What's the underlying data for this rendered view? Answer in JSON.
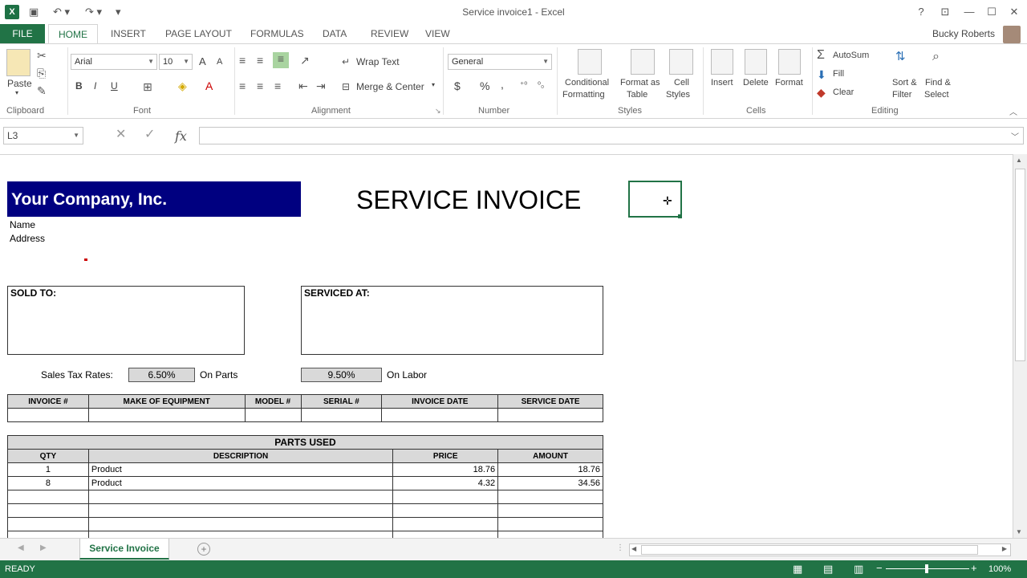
{
  "window": {
    "title": "Service invoice1 - Excel",
    "app_icon": "X"
  },
  "ribbon_tabs": [
    "FILE",
    "HOME",
    "INSERT",
    "PAGE LAYOUT",
    "FORMULAS",
    "DATA",
    "REVIEW",
    "VIEW"
  ],
  "user": {
    "name": "Bucky Roberts"
  },
  "ribbon": {
    "clipboard": {
      "label": "Clipboard",
      "paste": "Paste"
    },
    "font": {
      "label": "Font",
      "family": "Arial",
      "size": "10",
      "bold": "B",
      "italic": "I",
      "underline": "U",
      "grow": "A",
      "shrink": "A"
    },
    "alignment": {
      "label": "Alignment",
      "wrap": "Wrap Text",
      "merge": "Merge & Center"
    },
    "number": {
      "label": "Number",
      "format": "General",
      "currency": "$",
      "percent": "%",
      "comma": ","
    },
    "styles": {
      "label": "Styles",
      "conditional_1": "Conditional",
      "conditional_2": "Formatting",
      "format_table_1": "Format as",
      "format_table_2": "Table",
      "cell_styles_1": "Cell",
      "cell_styles_2": "Styles"
    },
    "cells": {
      "label": "Cells",
      "insert": "Insert",
      "delete": "Delete",
      "format": "Format"
    },
    "editing": {
      "label": "Editing",
      "autosum": "AutoSum",
      "fill": "Fill",
      "clear": "Clear",
      "sort_1": "Sort &",
      "sort_2": "Filter",
      "find_1": "Find &",
      "find_2": "Select"
    }
  },
  "formula_bar": {
    "name_box": "L3",
    "fx": "fx",
    "content": ""
  },
  "sheet": {
    "company": "Your Company, Inc.",
    "heading": "SERVICE INVOICE",
    "name_label": "Name",
    "address_label": "Address",
    "sold_to": "SOLD TO:",
    "serviced_at": "SERVICED AT:",
    "tax_label": "Sales Tax Rates:",
    "tax_parts": "6.50%",
    "on_parts": "On Parts",
    "tax_labor": "9.50%",
    "on_labor": "On Labor",
    "info_headers": [
      "INVOICE #",
      "MAKE OF EQUIPMENT",
      "MODEL #",
      "SERIAL #",
      "INVOICE DATE",
      "SERVICE DATE"
    ],
    "parts_title": "PARTS USED",
    "parts_headers": [
      "QTY",
      "DESCRIPTION",
      "PRICE",
      "AMOUNT"
    ],
    "parts_rows": [
      {
        "qty": "1",
        "desc": "Product",
        "price": "18.76",
        "amount": "18.76"
      },
      {
        "qty": "8",
        "desc": "Product",
        "price": "4.32",
        "amount": "34.56"
      }
    ]
  },
  "sheet_tabs": [
    "Service Invoice"
  ],
  "status": {
    "ready": "READY",
    "zoom": "100%"
  },
  "colors": {
    "excel_green": "#217346",
    "company_banner": "#000080"
  }
}
